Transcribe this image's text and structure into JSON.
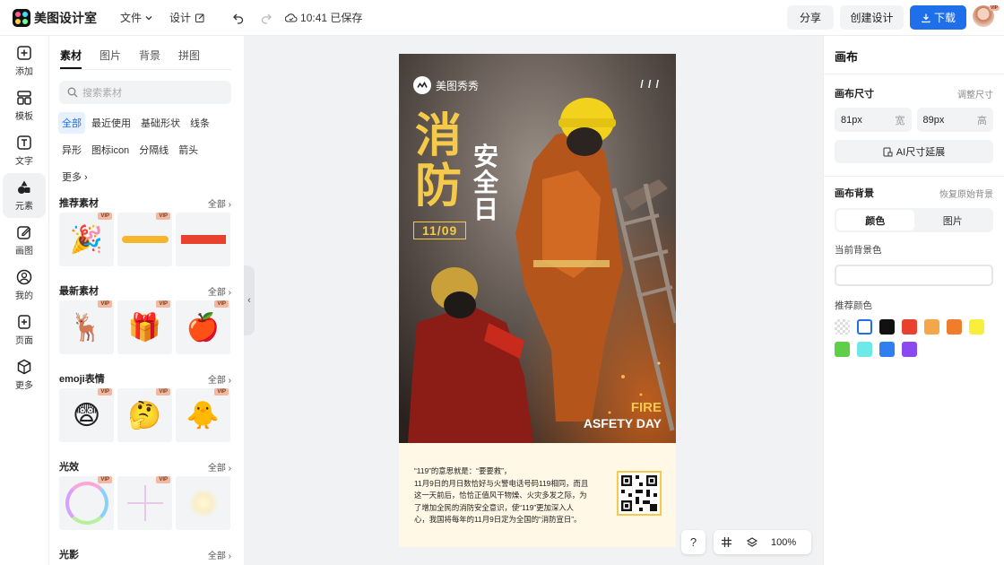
{
  "app": {
    "name": "美图设计室"
  },
  "header": {
    "menu_file": "文件",
    "menu_design": "设计",
    "save_status": "10:41 已保存",
    "share_label": "分享",
    "create_label": "创建设计",
    "download_label": "下载",
    "vip_badge": "VIP"
  },
  "rail": [
    {
      "label": "添加",
      "icon": "plus-square-icon"
    },
    {
      "label": "模板",
      "icon": "template-icon"
    },
    {
      "label": "文字",
      "icon": "text-icon"
    },
    {
      "label": "元素",
      "icon": "shapes-icon"
    },
    {
      "label": "画图",
      "icon": "draw-icon"
    },
    {
      "label": "我的",
      "icon": "user-icon"
    },
    {
      "label": "页面",
      "icon": "page-add-icon"
    },
    {
      "label": "更多",
      "icon": "cube-icon"
    }
  ],
  "panel": {
    "tabs": [
      "素材",
      "图片",
      "背景",
      "拼图"
    ],
    "search_placeholder": "搜索素材",
    "chips": [
      "全部",
      "最近使用",
      "基础形状",
      "线条",
      "异形",
      "图标icon",
      "分隔线",
      "箭头",
      "更多"
    ],
    "all_label": "全部",
    "vip": "VIP",
    "sections": [
      "推荐素材",
      "最新素材",
      "emoji表情",
      "光效",
      "光影"
    ]
  },
  "poster": {
    "brand": "美图秀秀",
    "title_big_1": "消",
    "title_big_2": "防",
    "title_small": [
      "安",
      "全",
      "日"
    ],
    "date": "11/09",
    "en_1": "FIRE",
    "en_2": "ASFETY DAY",
    "body_lines": [
      "“119”的意思就是：“要要救”，",
      "11月9日的月日数恰好与火警电话号码119相同，而且",
      "这一天前后，恰恰正值风干物燥、火灾多发之际，为",
      "了增加全民的消防安全意识，使“119”更加深入人",
      "心，我国将每年的11月9日定为全国的“消防宣日”。"
    ]
  },
  "canvas_tools": {
    "help": "?",
    "zoom": "100%"
  },
  "right_panel": {
    "title": "画布",
    "size_label": "画布尺寸",
    "adjust_label": "调整尺寸",
    "width_value": "81px",
    "width_unit": "宽",
    "height_value": "89px",
    "height_unit": "高",
    "ai_extend_label": "AI尺寸延展",
    "bg_label": "画布背景",
    "restore_label": "恢复原始背景",
    "bg_tab_color": "颜色",
    "bg_tab_image": "图片",
    "current_bg_label": "当前背景色",
    "recommend_label": "推荐颜色",
    "swatches": [
      "transparent",
      "#ffffff",
      "#111111",
      "#e8412e",
      "#f4a64a",
      "#ef7d2c",
      "#f7ef3a",
      "#5fcf4a",
      "#6fe8e8",
      "#2f7ff0",
      "#8a4af0"
    ]
  },
  "colors": {
    "accent": "#1f6feb",
    "poster_yellow": "#f5c94a"
  }
}
